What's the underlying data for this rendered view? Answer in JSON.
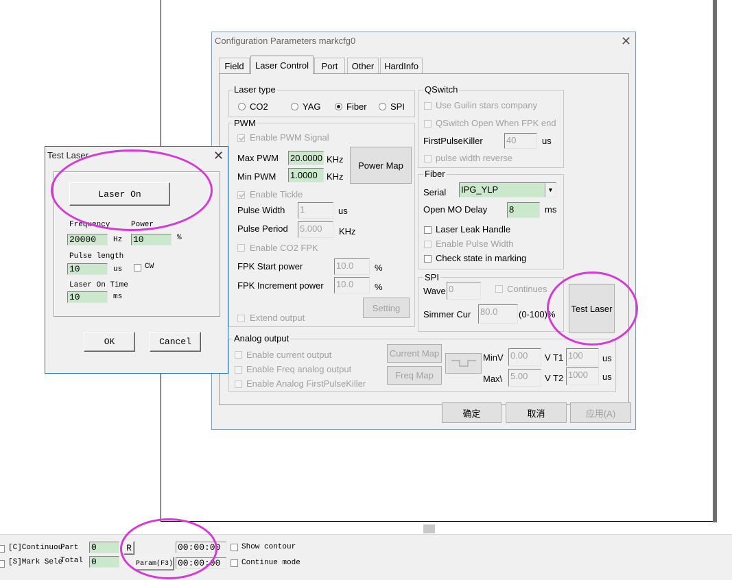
{
  "config_dialog": {
    "title": "Configuration Parameters markcfg0",
    "tabs": [
      "Field",
      "Laser Control",
      "Port",
      "Other",
      "HardInfo"
    ],
    "laser_type": {
      "label": "Laser type",
      "options": [
        "CO2",
        "YAG",
        "Fiber",
        "SPI"
      ],
      "selected": "Fiber"
    },
    "qswitch": {
      "label": "QSwitch",
      "use_guilin": "Use Guilin stars company",
      "open_when_fpk": "QSwitch Open When FPK end",
      "first_pulse_killer_label": "FirstPulseKiller",
      "first_pulse_killer_value": "40",
      "first_pulse_killer_unit": "us",
      "pulse_width_reverse": "pulse width reverse"
    },
    "pwm": {
      "label": "PWM",
      "enable_pwm": "Enable PWM Signal",
      "max_pwm_label": "Max PWM",
      "max_pwm_value": "20.0000",
      "max_pwm_unit": "KHz",
      "min_pwm_label": "Min PWM",
      "min_pwm_value": "1.0000",
      "min_pwm_unit": "KHz",
      "power_map": "Power Map",
      "enable_tickle": "Enable Tickle",
      "pulse_width_label": "Pulse Width",
      "pulse_width_value": "1",
      "pulse_width_unit": "us",
      "pulse_period_label": "Pulse Period",
      "pulse_period_value": "5.000",
      "pulse_period_unit": "KHz",
      "enable_co2_fpk": "Enable CO2 FPK",
      "fpk_start_label": "FPK Start power",
      "fpk_start_value": "10.0",
      "fpk_increment_label": "FPK Increment power",
      "fpk_increment_value": "10.0",
      "percent": "%",
      "setting": "Setting",
      "extend_output": "Extend output"
    },
    "fiber": {
      "label": "Fiber",
      "serial_label": "Serial",
      "serial_value": "IPG_YLP",
      "open_mo_delay_label": "Open MO Delay",
      "open_mo_delay_value": "8",
      "open_mo_delay_unit": "ms",
      "laser_leak_handle": "Laser Leak Handle",
      "enable_pulse_width": "Enable Pulse Width",
      "check_state": "Check state in marking"
    },
    "spi": {
      "label": "SPI",
      "wave_label": "Wave",
      "wave_value": "0",
      "continues": "Continues",
      "simmer_label": "Simmer Cur",
      "simmer_value": "80.0",
      "simmer_unit": "(0-100)%"
    },
    "test_laser_button": "Test Laser",
    "analog": {
      "label": "Analog output",
      "enable_current": "Enable current output",
      "enable_freq": "Enable Freq analog output",
      "enable_fpk": "Enable Analog FirstPulseKiller",
      "current_map": "Current Map",
      "freq_map": "Freq Map",
      "minv_label": "MinV",
      "minv_value": "0.00",
      "maxv_label": "Max\\",
      "maxv_value": "5.00",
      "vt1_label": "V T1",
      "vt1_value": "100",
      "vt2_label": "V T2",
      "vt2_value": "1000",
      "us": "us"
    },
    "ok": "确定",
    "cancel": "取消",
    "apply": "应用(A)"
  },
  "test_dialog": {
    "title": "Test Laser",
    "laser_on": "Laser On",
    "frequency_label": "Frequency",
    "frequency_value": "20000",
    "frequency_unit": "Hz",
    "power_label": "Power",
    "power_value": "10",
    "power_unit": "%",
    "pulse_length_label": "Pulse length",
    "pulse_length_value": "10",
    "pulse_length_unit": "us",
    "cw_label": "CW",
    "laser_on_time_label": "Laser On Time",
    "laser_on_time_value": "10",
    "laser_on_time_unit": "ms",
    "ok": "OK",
    "cancel": "Cancel"
  },
  "statusbar": {
    "continuous_label": "[C]Continuou",
    "part_label": "Part",
    "part_value": "0",
    "r_button": "R",
    "time1": "00:00:00",
    "show_contour": "Show contour",
    "mark_select_label": "[S]Mark Sele",
    "total_label": "Total",
    "total_value": "0",
    "param_button": "Param(F3)",
    "time2": "00:00:00",
    "continue_mode": "Continue mode"
  }
}
